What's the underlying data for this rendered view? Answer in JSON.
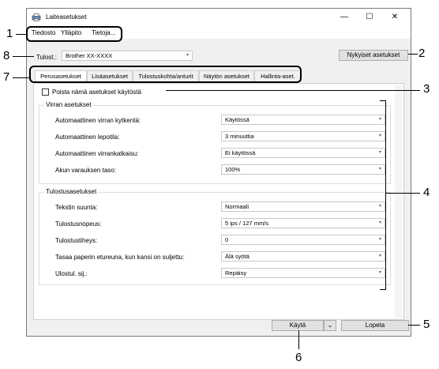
{
  "window": {
    "title": "Laiteasetukset",
    "minimize": "—",
    "maximize": "☐",
    "close": "✕"
  },
  "menu": {
    "items": [
      "Tiedosto",
      "Ylläpito",
      "Tietoja..."
    ]
  },
  "printer": {
    "label": "Tulost.:",
    "value": "Brother XX-XXXX",
    "current_settings_button": "Nykyiset asetukset"
  },
  "tabs": [
    "Perusasetukset",
    "Lisäasetukset",
    "Tulostuskohta/anturit",
    "Näytön asetukset",
    "Hallinta-aset."
  ],
  "disable_checkbox": {
    "label": "Poista nämä asetukset käytöstä",
    "checked": false
  },
  "power_group": {
    "title": "Virran asetukset",
    "rows": [
      {
        "label": "Automaattinen virran kytkentä:",
        "value": "Käytössä"
      },
      {
        "label": "Automaattinen lepotila:",
        "value": "3 minuuttia"
      },
      {
        "label": "Automaattinen virrankatkaisu:",
        "value": "Ei käytössä"
      },
      {
        "label": "Akun varauksen taso:",
        "value": "100%"
      }
    ]
  },
  "print_group": {
    "title": "Tulostusasetukset",
    "rows": [
      {
        "label": "Tekstin suunta:",
        "value": "Normaali"
      },
      {
        "label": "Tulostusnopeus:",
        "value": "5 ips / 127 mm/s"
      },
      {
        "label": "Tulostustiheys:",
        "value": "0"
      },
      {
        "label": "Tasaa paperin etureuna, kun kansi on suljettu:",
        "value": "Älä syötä"
      },
      {
        "label": "Ulostul. sij.:",
        "value": "Repäisy"
      }
    ]
  },
  "footer": {
    "apply_button": "Käytä",
    "apply_dropdown": "⌄",
    "exit_button": "Lopeta"
  },
  "callouts": {
    "c1": "1",
    "c2": "2",
    "c3": "3",
    "c4": "4",
    "c5": "5",
    "c6": "6",
    "c7": "7",
    "c8": "8"
  }
}
